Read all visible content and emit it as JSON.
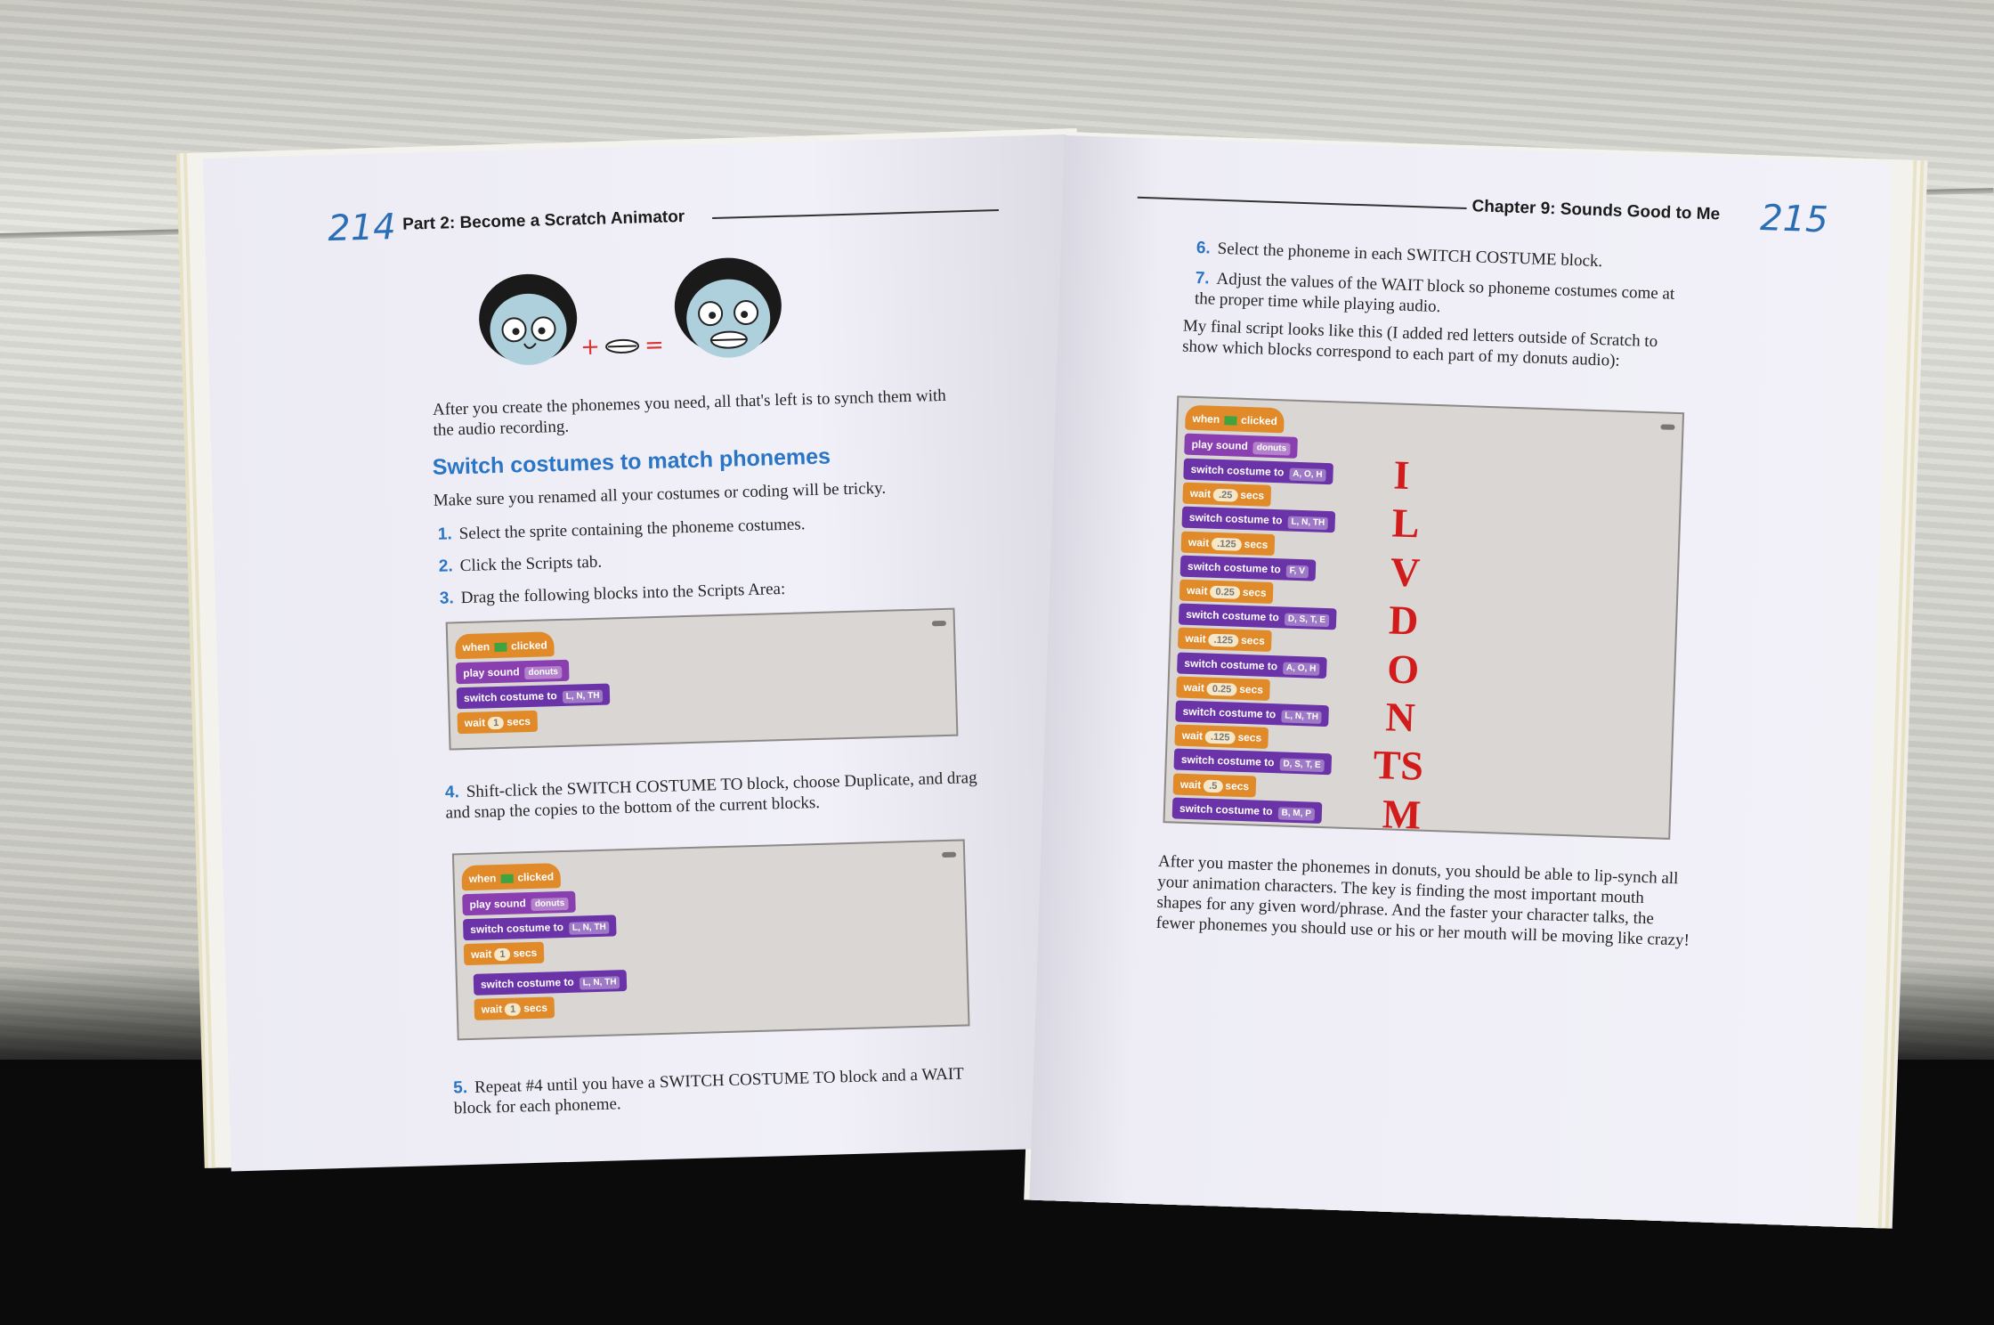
{
  "left_page": {
    "page_number": "214",
    "running_head": "Part 2: Become a Scratch Animator",
    "intro": "After you create the phonemes you need, all that's left is to synch them with the audio recording.",
    "heading": "Switch costumes to match phonemes",
    "lead": "Make sure you renamed all your costumes or coding will be tricky.",
    "steps": [
      {
        "n": "1.",
        "text": "Select the sprite containing the phoneme costumes."
      },
      {
        "n": "2.",
        "text": "Click the Scripts tab."
      },
      {
        "n": "3.",
        "text": "Drag the following blocks into the Scripts Area:"
      },
      {
        "n": "4.",
        "text": "Shift-click the SWITCH COSTUME TO block, choose Duplicate, and drag and snap the copies to the bottom of the current blocks."
      },
      {
        "n": "5.",
        "text": "Repeat #4 until you have a SWITCH COSTUME TO block and a WAIT block for each phoneme."
      }
    ],
    "faces_symbols": {
      "plus": "+",
      "equals": "="
    }
  },
  "right_page": {
    "page_number": "215",
    "running_head": "Chapter 9: Sounds Good to Me",
    "steps": [
      {
        "n": "6.",
        "text": "Select the phoneme in each SWITCH COSTUME block."
      },
      {
        "n": "7.",
        "text": "Adjust the values of the WAIT block so phoneme costumes come at the proper time while playing audio."
      }
    ],
    "script_intro": "My final script looks like this (I added red letters outside of Scratch to show which blocks correspond to each part of my donuts audio):",
    "closing": "After you master the phonemes in donuts, you should be able to lip-synch all your animation characters. The key is finding the most important mouth shapes for any given word/phrase. And the faster your character talks, the fewer phonemes you should use or his or her mouth will be moving like crazy!"
  },
  "scratch": {
    "when": "when",
    "clicked": "clicked",
    "play_sound": "play sound",
    "sound_name": "donuts",
    "switch_costume_to": "switch costume to",
    "wait": "wait",
    "secs": "secs",
    "fig1": [
      {
        "type": "switch",
        "costume": "L, N, TH"
      },
      {
        "type": "wait",
        "value": "1"
      }
    ],
    "fig2": [
      {
        "type": "switch",
        "costume": "L, N, TH"
      },
      {
        "type": "wait",
        "value": "1"
      },
      {
        "type": "switch",
        "costume": "L, N, TH"
      },
      {
        "type": "wait",
        "value": "1"
      }
    ],
    "final": [
      {
        "type": "switch",
        "costume": "A, O, H",
        "letter": "I"
      },
      {
        "type": "wait",
        "value": ".25"
      },
      {
        "type": "switch",
        "costume": "L, N, TH",
        "letter": "L"
      },
      {
        "type": "wait",
        "value": ".125"
      },
      {
        "type": "switch",
        "costume": "F, V",
        "letter": "V"
      },
      {
        "type": "wait",
        "value": "0.25"
      },
      {
        "type": "switch",
        "costume": "D, S, T, E",
        "letter": "D"
      },
      {
        "type": "wait",
        "value": ".125"
      },
      {
        "type": "switch",
        "costume": "A, O, H",
        "letter": "O"
      },
      {
        "type": "wait",
        "value": "0.25"
      },
      {
        "type": "switch",
        "costume": "L, N, TH",
        "letter": "N"
      },
      {
        "type": "wait",
        "value": ".125"
      },
      {
        "type": "switch",
        "costume": "D, S, T, E",
        "letter": "TS"
      },
      {
        "type": "wait",
        "value": ".5"
      },
      {
        "type": "switch",
        "costume": "B, M, P",
        "letter": "M"
      }
    ]
  },
  "colors": {
    "accent_blue": "#2a75c5",
    "event_orange": "#e08a2a",
    "sound_purple": "#8a3fb0",
    "looks_violet": "#6a34a8",
    "annotation_red": "#d21b1b"
  }
}
